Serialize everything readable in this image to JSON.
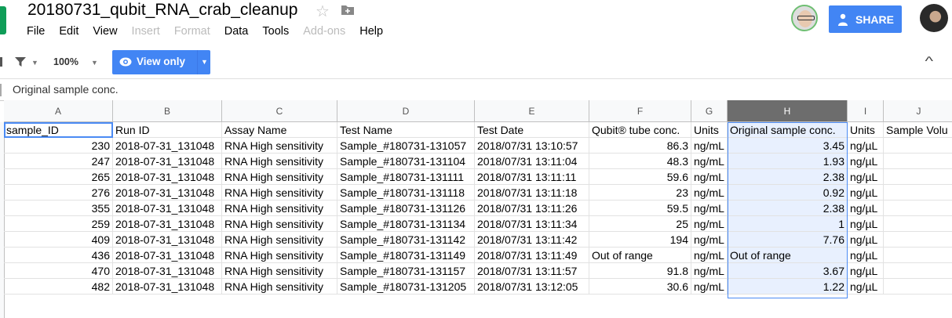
{
  "doc": {
    "title": "20180731_qubit_RNA_crab_cleanup"
  },
  "menu": [
    "File",
    "Edit",
    "View",
    "Insert",
    "Format",
    "Data",
    "Tools",
    "Add-ons",
    "Help"
  ],
  "menu_disabled": [
    false,
    false,
    false,
    true,
    true,
    false,
    false,
    true,
    false
  ],
  "share_label": "SHARE",
  "toolbar": {
    "zoom": "100%",
    "view_only": "View only"
  },
  "formula_bar": {
    "content": "Original sample conc."
  },
  "columns": [
    "A",
    "B",
    "C",
    "D",
    "E",
    "F",
    "G",
    "H",
    "I",
    "J"
  ],
  "selected_column": "H",
  "accent_color": "#4285f4",
  "header_row": [
    "sample_ID",
    "Run ID",
    "Assay Name",
    "Test Name",
    "Test Date",
    "Qubit® tube conc.",
    "Units",
    "Original sample conc.",
    "Units",
    "Sample Volu"
  ],
  "rows": [
    [
      "230",
      "2018-07-31_131048",
      "RNA High sensitivity",
      "Sample_#180731-131057",
      "2018/07/31 13:10:57",
      "86.3",
      "ng/mL",
      "3.45",
      "ng/µL",
      ""
    ],
    [
      "247",
      "2018-07-31_131048",
      "RNA High sensitivity",
      "Sample_#180731-131104",
      "2018/07/31 13:11:04",
      "48.3",
      "ng/mL",
      "1.93",
      "ng/µL",
      ""
    ],
    [
      "265",
      "2018-07-31_131048",
      "RNA High sensitivity",
      "Sample_#180731-131111",
      "2018/07/31 13:11:11",
      "59.6",
      "ng/mL",
      "2.38",
      "ng/µL",
      ""
    ],
    [
      "276",
      "2018-07-31_131048",
      "RNA High sensitivity",
      "Sample_#180731-131118",
      "2018/07/31 13:11:18",
      "23",
      "ng/mL",
      "0.92",
      "ng/µL",
      ""
    ],
    [
      "355",
      "2018-07-31_131048",
      "RNA High sensitivity",
      "Sample_#180731-131126",
      "2018/07/31 13:11:26",
      "59.5",
      "ng/mL",
      "2.38",
      "ng/µL",
      ""
    ],
    [
      "259",
      "2018-07-31_131048",
      "RNA High sensitivity",
      "Sample_#180731-131134",
      "2018/07/31 13:11:34",
      "25",
      "ng/mL",
      "1",
      "ng/µL",
      ""
    ],
    [
      "409",
      "2018-07-31_131048",
      "RNA High sensitivity",
      "Sample_#180731-131142",
      "2018/07/31 13:11:42",
      "194",
      "ng/mL",
      "7.76",
      "ng/µL",
      ""
    ],
    [
      "436",
      "2018-07-31_131048",
      "RNA High sensitivity",
      "Sample_#180731-131149",
      "2018/07/31 13:11:49",
      "Out of range",
      "ng/mL",
      "Out of range",
      "ng/µL",
      ""
    ],
    [
      "470",
      "2018-07-31_131048",
      "RNA High sensitivity",
      "Sample_#180731-131157",
      "2018/07/31 13:11:57",
      "91.8",
      "ng/mL",
      "3.67",
      "ng/µL",
      ""
    ],
    [
      "482",
      "2018-07-31_131048",
      "RNA High sensitivity",
      "Sample_#180731-131205",
      "2018/07/31 13:12:05",
      "30.6",
      "ng/mL",
      "1.22",
      "ng/µL",
      ""
    ]
  ]
}
